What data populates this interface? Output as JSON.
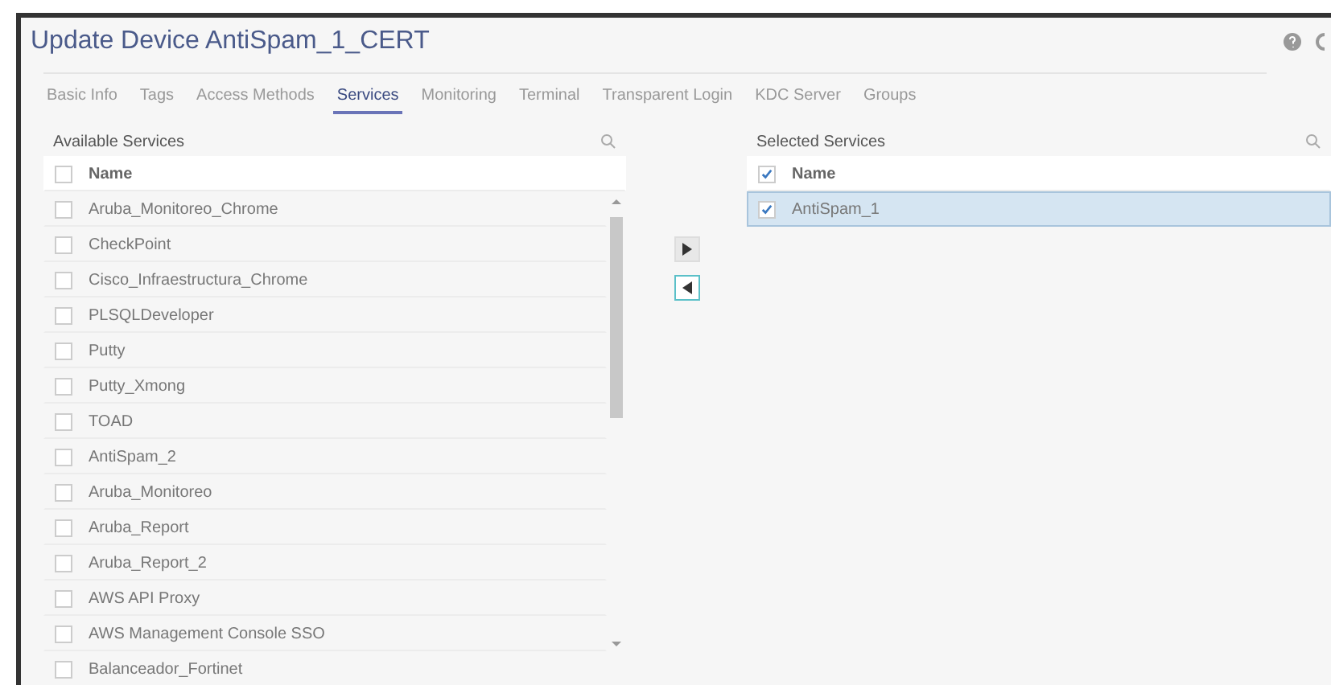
{
  "window": {
    "title": "Update Device AntiSpam_1_CERT"
  },
  "tabs": [
    {
      "label": "Basic Info",
      "selected": false
    },
    {
      "label": "Tags",
      "selected": false
    },
    {
      "label": "Access Methods",
      "selected": false
    },
    {
      "label": "Services",
      "selected": true
    },
    {
      "label": "Monitoring",
      "selected": false
    },
    {
      "label": "Terminal",
      "selected": false
    },
    {
      "label": "Transparent Login",
      "selected": false
    },
    {
      "label": "KDC Server",
      "selected": false
    },
    {
      "label": "Groups",
      "selected": false
    }
  ],
  "available": {
    "title": "Available Services",
    "header": {
      "label": "Name",
      "checked": false
    },
    "rows": [
      {
        "name": "Aruba_Monitoreo_Chrome",
        "checked": false,
        "selected": false
      },
      {
        "name": "CheckPoint",
        "checked": false,
        "selected": false
      },
      {
        "name": "Cisco_Infraestructura_Chrome",
        "checked": false,
        "selected": false
      },
      {
        "name": "PLSQLDeveloper",
        "checked": false,
        "selected": false
      },
      {
        "name": "Putty",
        "checked": false,
        "selected": false
      },
      {
        "name": "Putty_Xmong",
        "checked": false,
        "selected": false
      },
      {
        "name": "TOAD",
        "checked": false,
        "selected": false
      },
      {
        "name": "AntiSpam_2",
        "checked": false,
        "selected": false
      },
      {
        "name": "Aruba_Monitoreo",
        "checked": false,
        "selected": false
      },
      {
        "name": "Aruba_Report",
        "checked": false,
        "selected": false
      },
      {
        "name": "Aruba_Report_2",
        "checked": false,
        "selected": false
      },
      {
        "name": "AWS API Proxy",
        "checked": false,
        "selected": false
      },
      {
        "name": "AWS Management Console SSO",
        "checked": false,
        "selected": false
      },
      {
        "name": "Balanceador_Fortinet",
        "checked": false,
        "selected": false
      }
    ]
  },
  "selected": {
    "title": "Selected Services",
    "header": {
      "label": "Name",
      "checked": true
    },
    "rows": [
      {
        "name": "AntiSpam_1",
        "checked": true,
        "selected": true
      }
    ]
  }
}
